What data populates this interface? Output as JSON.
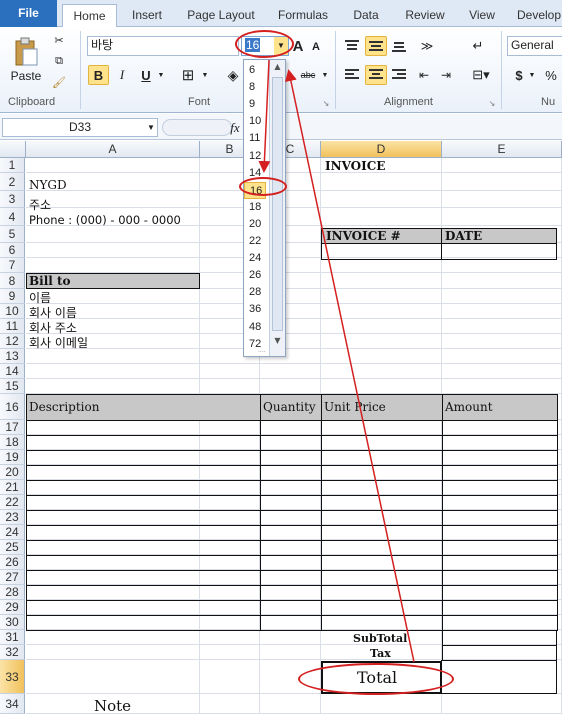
{
  "ribbon_tabs": [
    "File",
    "Home",
    "Insert",
    "Page Layout",
    "Formulas",
    "Data",
    "Review",
    "View",
    "Develop"
  ],
  "clipboard": {
    "paste_label": "Paste",
    "group_label": "Clipboard"
  },
  "font": {
    "name": "바탕",
    "size": "16",
    "group_label": "Font",
    "grow_icon": "A",
    "shrink_icon": "A",
    "bold": "B",
    "italic": "I",
    "underline": "U",
    "abc": "abc"
  },
  "alignment": {
    "group_label": "Alignment"
  },
  "number": {
    "format": "General",
    "currency": "$",
    "percent": "%",
    "group_label": "Nu"
  },
  "formula_bar": {
    "name_box": "D33",
    "fx": "fx"
  },
  "columns": [
    "A",
    "B",
    "C",
    "D",
    "E"
  ],
  "rows": [
    "1",
    "2",
    "3",
    "4",
    "5",
    "6",
    "7",
    "8",
    "9",
    "10",
    "11",
    "12",
    "13",
    "14",
    "15",
    "16",
    "17",
    "18",
    "19",
    "20",
    "21",
    "22",
    "23",
    "24",
    "25",
    "26",
    "27",
    "28",
    "29",
    "30",
    "31",
    "32",
    "33",
    "34"
  ],
  "font_size_list": [
    "6",
    "8",
    "9",
    "10",
    "11",
    "12",
    "14",
    "16",
    "18",
    "20",
    "22",
    "24",
    "26",
    "28",
    "36",
    "48",
    "72"
  ],
  "font_size_selected": "16",
  "sheet": {
    "invoice_title": "INVOICE",
    "company": "NYGD",
    "address": "주소",
    "phone": "Phone : (000) - 000 - 0000",
    "invoice_no_label": "INVOICE #",
    "date_label": "DATE",
    "bill_to": "Bill to",
    "name": "이름",
    "company_name": "회사 이름",
    "company_address": "회사 주소",
    "company_email": "회사 이메일",
    "headers": [
      "Description",
      "Quantity",
      "Unit Price",
      "Amount"
    ],
    "subtotal": "SubTotal",
    "tax": "Tax",
    "total": "Total",
    "note": "Note"
  },
  "colors": {
    "accent": "#2b6fbf",
    "annotation": "#d42020",
    "header_gray": "#c8c8c8"
  }
}
